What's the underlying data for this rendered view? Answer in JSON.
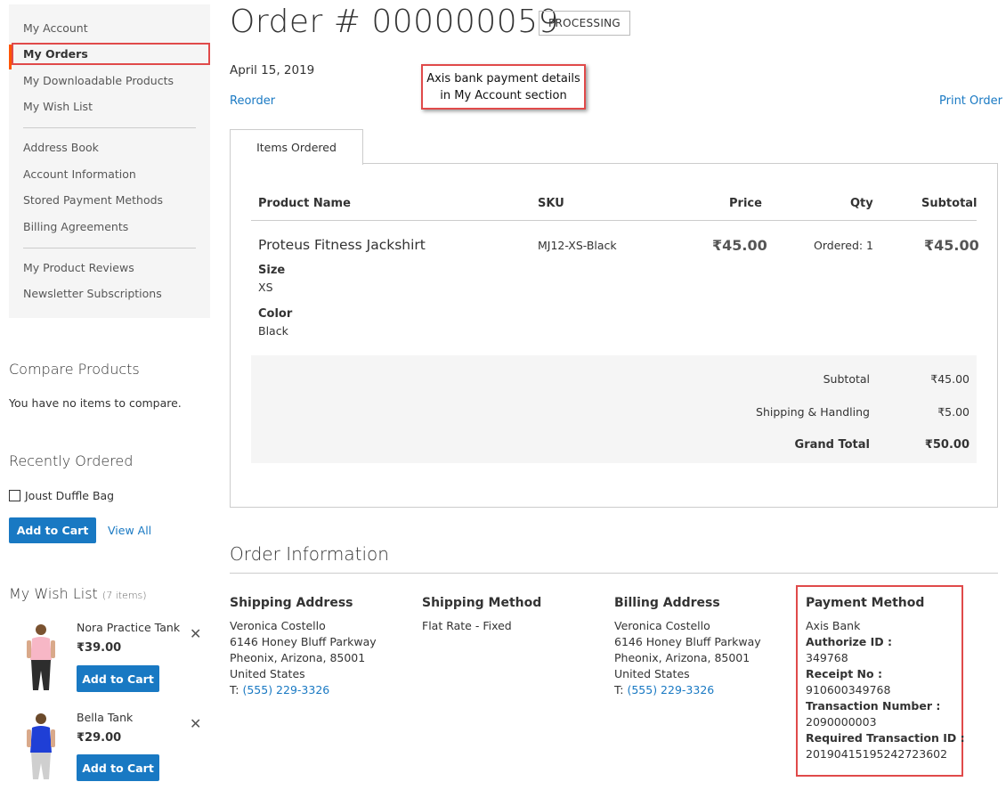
{
  "sidebar": {
    "nav": [
      {
        "label": "My Account"
      },
      {
        "label": "My Orders",
        "active": true
      },
      {
        "label": "My Downloadable Products"
      },
      {
        "label": "My Wish List"
      },
      {
        "label": "Address Book"
      },
      {
        "label": "Account Information"
      },
      {
        "label": "Stored Payment Methods"
      },
      {
        "label": "Billing Agreements"
      },
      {
        "label": "My Product Reviews"
      },
      {
        "label": "Newsletter Subscriptions"
      }
    ],
    "compare": {
      "title": "Compare Products",
      "empty_text": "You have no items to compare."
    },
    "recently_ordered": {
      "title": "Recently Ordered",
      "item": "Joust Duffle Bag",
      "add_to_cart": "Add to Cart",
      "view_all": "View All"
    },
    "wishlist": {
      "title": "My Wish List",
      "count": "(7 items)",
      "items": [
        {
          "name": "Nora Practice Tank",
          "price": "₹39.00",
          "button": "Add to Cart"
        },
        {
          "name": "Bella Tank",
          "price": "₹29.00",
          "button": "Add to Cart"
        }
      ]
    }
  },
  "order": {
    "title": "Order # 000000059",
    "status": "PROCESSING",
    "date": "April 15, 2019",
    "reorder": "Reorder",
    "print": "Print Order",
    "annotation_line1": "Axis bank payment details",
    "annotation_line2": "in My Account section"
  },
  "items": {
    "tab": "Items Ordered",
    "headers": {
      "name": "Product Name",
      "sku": "SKU",
      "price": "Price",
      "qty": "Qty",
      "subtotal": "Subtotal"
    },
    "row": {
      "name": "Proteus Fitness Jackshirt",
      "size_label": "Size",
      "size": "XS",
      "color_label": "Color",
      "color": "Black",
      "sku": "MJ12-XS-Black",
      "price": "₹45.00",
      "qty": "Ordered: 1",
      "subtotal": "₹45.00"
    },
    "totals": {
      "subtotal_label": "Subtotal",
      "subtotal": "₹45.00",
      "shipping_label": "Shipping & Handling",
      "shipping": "₹5.00",
      "grand_label": "Grand Total",
      "grand": "₹50.00"
    }
  },
  "info": {
    "title": "Order Information",
    "shipping_address": {
      "title": "Shipping Address",
      "name": "Veronica Costello",
      "street": "6146 Honey Bluff Parkway",
      "city": "Pheonix, Arizona, 85001",
      "country": "United States",
      "phone_prefix": "T: ",
      "phone": "(555) 229-3326"
    },
    "shipping_method": {
      "title": "Shipping Method",
      "value": "Flat Rate - Fixed"
    },
    "billing_address": {
      "title": "Billing Address",
      "name": "Veronica Costello",
      "street": "6146 Honey Bluff Parkway",
      "city": "Pheonix, Arizona, 85001",
      "country": "United States",
      "phone_prefix": "T: ",
      "phone": "(555) 229-3326"
    },
    "payment": {
      "title": "Payment Method",
      "method": "Axis Bank",
      "auth_label": "Authorize ID :",
      "auth": "349768",
      "receipt_label": "Receipt No :",
      "receipt": "910600349768",
      "txn_label": "Transaction Number :",
      "txn": "2090000003",
      "req_label": "Required Transaction ID :",
      "req": "20190415195242723602"
    }
  },
  "colors": {
    "accent": "#1979c3",
    "highlight": "#e04a4a",
    "active_bar": "#ff5501"
  }
}
